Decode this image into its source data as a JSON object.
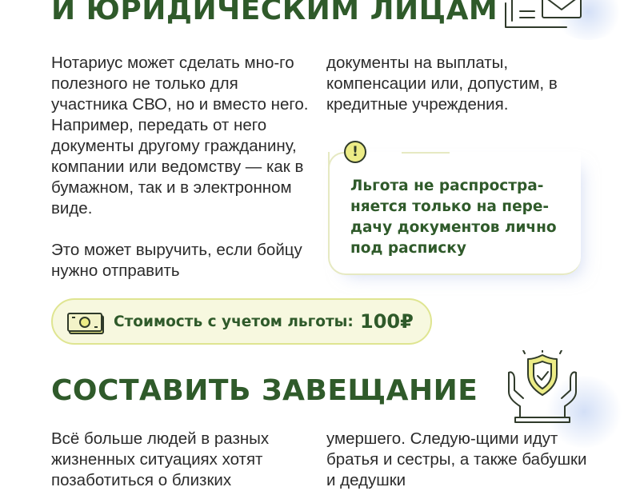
{
  "section1": {
    "heading": "И ЮРИДИЧЕСКИМ ЛИЦАМ",
    "icon": "documents-envelope-icon",
    "left_paragraph_1": "Нотариус может сделать мно-го полезного не только для участника СВО, но и вместо него. Например, передать от него документы другому гражданину, компании или ведомству — как в бумажном, так и в электронном виде.",
    "left_paragraph_2": "Это может выручить, если бойцу нужно отправить",
    "right_paragraph": "документы на выплаты, компенсации или, допустим, в кредитные учреждения.",
    "note": {
      "icon": "exclamation-icon",
      "symbol": "!",
      "text": "Льгота не распростра-няется только на пере-дачу документов лично под расписку"
    },
    "cost": {
      "icon": "banknote-icon",
      "label": "Стоимость с учетом льготы:",
      "value": "100₽"
    }
  },
  "section2": {
    "heading": "СОСТАВИТЬ ЗАВЕЩАНИЕ",
    "icon": "hands-shield-icon",
    "left_paragraph": "Всё больше людей в разных жизненных ситуациях хотят позаботиться о близких",
    "right_paragraph": "умершего. Следую-щими идут братья и сестры, а также бабушки и дедушки"
  },
  "colors": {
    "heading": "#2f5a2a",
    "body_text": "#2b2b2b",
    "accent_yellow": "#ecec86",
    "pill_bg": "#f7f8df",
    "pill_border": "#dfe591"
  }
}
